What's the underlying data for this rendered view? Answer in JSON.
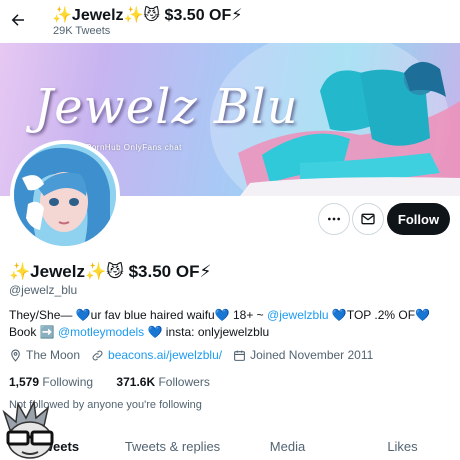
{
  "header": {
    "title": "✨Jewelz✨😼 $3.50 OF⚡",
    "tweet_count": "29K Tweets",
    "back_icon": "arrow-left-icon"
  },
  "banner": {
    "script_text": "Jewelz Blu",
    "logos_text": "PornHub  OnlyFans  chat",
    "watermark": "ALEXSEXUALITY@JEWELZBLU"
  },
  "actions": {
    "more_icon": "more-horizontal-icon",
    "message_icon": "envelope-icon",
    "follow_label": "Follow"
  },
  "profile": {
    "name": "✨Jewelz✨😼 $3.50 OF⚡",
    "handle": "@jewelz_blu",
    "bio": {
      "part1": "They/She— 💙ur fav blue haired waifu💙 18+ ~ ",
      "link1": "@jewelzblu",
      "part2": " 💙TOP .2% OF💙Book ➡️ ",
      "link2": "@motleymodels",
      "part3": " 💙 insta: onlyjewelzblu"
    },
    "location": "The Moon",
    "website": "beacons.ai/jewelzblu/",
    "joined": "Joined November 2011",
    "following_count": "1,579",
    "following_label": "Following",
    "followers_count": "371.6K",
    "followers_label": "Followers",
    "followed_by": "Not followed by anyone you're following"
  },
  "tabs": [
    {
      "label": "Tweets",
      "active": true
    },
    {
      "label": "Tweets & replies",
      "active": false
    },
    {
      "label": "Media",
      "active": false
    },
    {
      "label": "Likes",
      "active": false
    }
  ],
  "colors": {
    "accent": "#1d9bf0",
    "text": "#0f1419",
    "secondary": "#536471",
    "follow_button": "#0f1419"
  }
}
